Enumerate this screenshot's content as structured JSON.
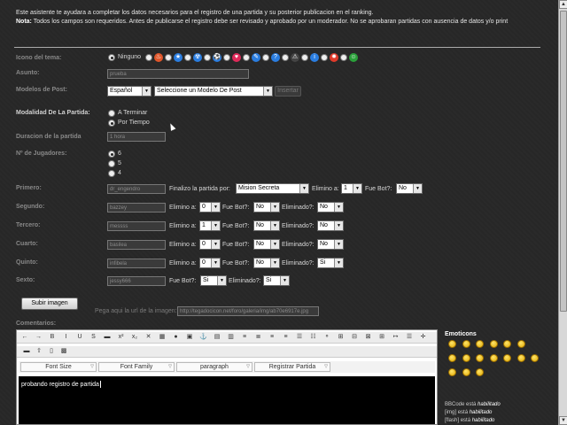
{
  "intro": {
    "line1": "Este asistente te ayudara a completar los datos necesarios para el registro de una partida y su posterior publicacion en el ranking.",
    "note_label": "Nota:",
    "note_text": " Todos los campos son requeridos. Antes de publicarse el registro debe ser revisado y aprobado por un moderador. No se aprobaran partidas con ausencia de datos y/o print"
  },
  "icon_field": {
    "label": "Icono del tema:",
    "none_label": "Ninguno",
    "icons": [
      "fire-icon",
      "star-icon",
      "radiation-icon",
      "soccer-icon",
      "heart-icon",
      "speech-icon",
      "question-icon",
      "warning-icon",
      "info-icon",
      "flame-icon",
      "frog-icon"
    ]
  },
  "asunto": {
    "label": "Asunto:",
    "value": "prueba"
  },
  "modelos": {
    "label": "Modelos de Post:",
    "language": "Español",
    "model": "Seleccione un Modelo De Post",
    "insert": "Insertar"
  },
  "modalidad": {
    "label": "Modalidad De La Partida:",
    "opt1": "A Terminar",
    "opt2": "Por Tiempo"
  },
  "duracion": {
    "label": "Duracion de la partida",
    "value": "1 hora"
  },
  "jugadores": {
    "label": "Nº de Jugadores:",
    "opt1": "6",
    "opt2": "5",
    "opt3": "4"
  },
  "finalizo": {
    "label": "Finalizo la partida por:",
    "value": "Mision Secreta"
  },
  "common": {
    "elimino": "Elimino a:",
    "fuebot": "Fue Bot?:",
    "fuebot2": "Fue Bot?:",
    "eliminado": "Eliminado?:",
    "eliminado2": "Eliminado?:"
  },
  "players": [
    {
      "label": "Primero:",
      "name": "dr_engendro",
      "elimino": "1",
      "bot": "No"
    },
    {
      "label": "Segundo:",
      "name": "bazzey",
      "elimino": "0",
      "bot": "No",
      "eliminado": "No"
    },
    {
      "label": "Tercero:",
      "name": "messss",
      "elimino": "1",
      "bot": "No",
      "eliminado": "No"
    },
    {
      "label": "Cuarto:",
      "name": "basilea",
      "elimino": "0",
      "bot": "No",
      "eliminado": "No"
    },
    {
      "label": "Quinto:",
      "name": "infibela",
      "elimino": "0",
      "bot": "No",
      "eliminado": "Si"
    },
    {
      "label": "Sexto:",
      "name": "jessy666",
      "bot": "Si",
      "eliminado": "Si"
    }
  ],
  "upload": {
    "button": "Subir imagen",
    "hint": "Pega aqui la url de la imagen:",
    "url": "http://tegadocicon.net/foro/galeria/img/ab70e6917e.jpg"
  },
  "comentarios": {
    "label": "Comentarios:"
  },
  "editor": {
    "font_size": "Font Size",
    "font_family": "Font Family",
    "paragraph": "paragraph",
    "registrar": "Registrar Partida",
    "content": "probando registro de partida"
  },
  "emoticons": {
    "title": "Emoticons",
    "bbcode_label": "BBCode",
    "esta": "está",
    "habilitado": "habilitado",
    "img": "[img]",
    "flash": "[flash]",
    "bbcode_state": "habilitado",
    "img_state": "habilitado",
    "flash_state": "habilitado"
  }
}
